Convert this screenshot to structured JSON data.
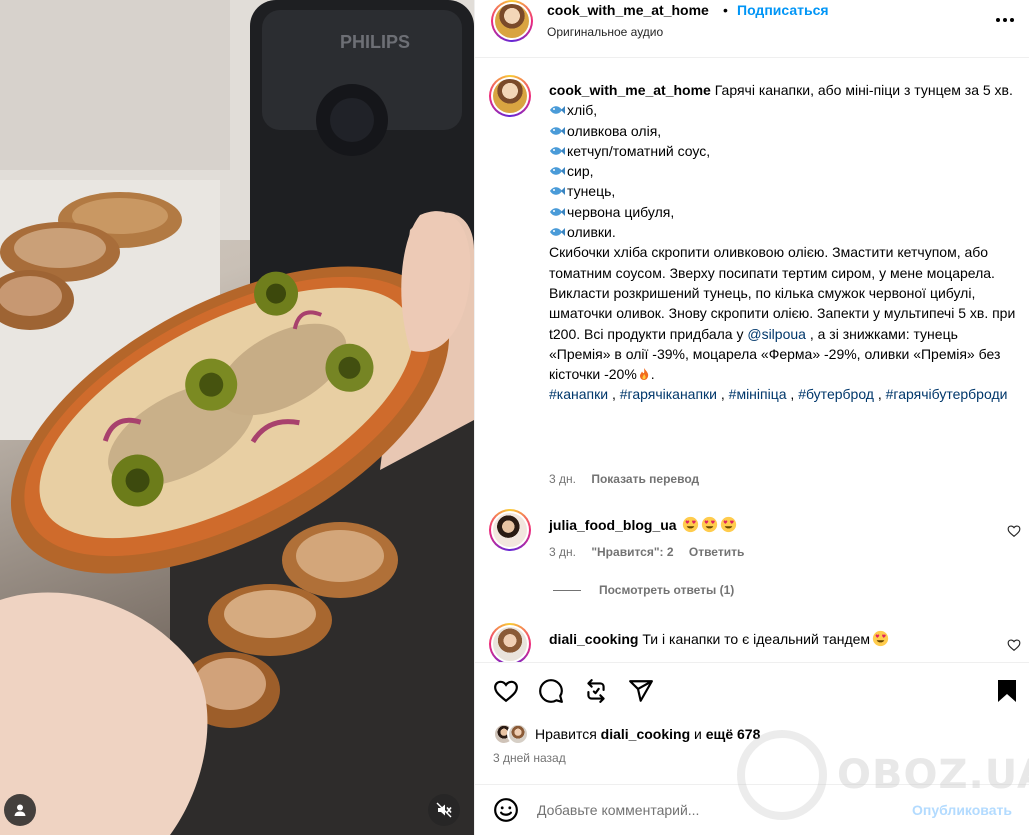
{
  "header": {
    "username": "cook_with_me_at_home",
    "separator": "•",
    "follow_label": "Подписаться",
    "audio_label": "Оригинальное аудио",
    "more_icon": "more-horizontal-icon"
  },
  "caption": {
    "username": "cook_with_me_at_home",
    "title": "Гарячі канапки, або міні-піци з тунцем за 5 хв.",
    "ingredients": [
      "хліб,",
      "оливкова олія,",
      "кетчуп/томатний соус,",
      "сир,",
      "тунець,",
      "червона цибуля,",
      "оливки."
    ],
    "body_before_mention": "Скибочки хліба скропити оливковою олією. Змастити кетчупом, або томатним соусом. Зверху посипати тертим сиром, у мене моцарела. Викласти розкришений тунець, по кілька смужок червоної цибулі, шматочки оливок. Знову скропити олією. Запекти у мультипечі 5 хв. при t200. Всі продукти придбала у",
    "mention": "@silpoua",
    "body_after_mention": ", а зі знижками: тунець «Премія» в олії -39%, моцарела «Ферма» -29%, оливки «Премія» без кісточки -20%",
    "body_end": ".",
    "hashtags": [
      "#канапки",
      "#гарячіканапки",
      "#мініпіца",
      "#бутерброд",
      "#гарячібутерброди"
    ],
    "hashtag_sep": ",",
    "time": "3 дн.",
    "translate_label": "Показать перевод"
  },
  "comments": [
    {
      "username": "julia_food_blog_ua",
      "text": "",
      "emoji_count": 3,
      "time": "3 дн.",
      "likes": "\"Нравится\": 2",
      "reply_label": "Ответить",
      "view_replies": "Посмотреть ответы (1)"
    },
    {
      "username": "diali_cooking",
      "text": "Ти і канапки то є ідеальний тандем",
      "emoji_count": 1
    }
  ],
  "actions": {
    "icons": [
      "heart-icon",
      "comment-icon",
      "repost-icon",
      "share-icon",
      "bookmark-icon"
    ],
    "likes_prefix": "Нравится",
    "likes_user": "diali_cooking",
    "likes_and": "и",
    "likes_more": "ещё 678",
    "time_ago": "3 дней назад"
  },
  "comment_box": {
    "placeholder": "Добавьте комментарий...",
    "publish_label": "Опубликовать"
  },
  "media": {
    "brand_text": "PHILIPS"
  },
  "watermark": {
    "text": "OBOZ.UA"
  },
  "colors": {
    "link_blue": "#0095f6",
    "hashtag_blue": "#00376b",
    "muted_grey": "#737373",
    "publish_disabled": "#b3dbff"
  }
}
